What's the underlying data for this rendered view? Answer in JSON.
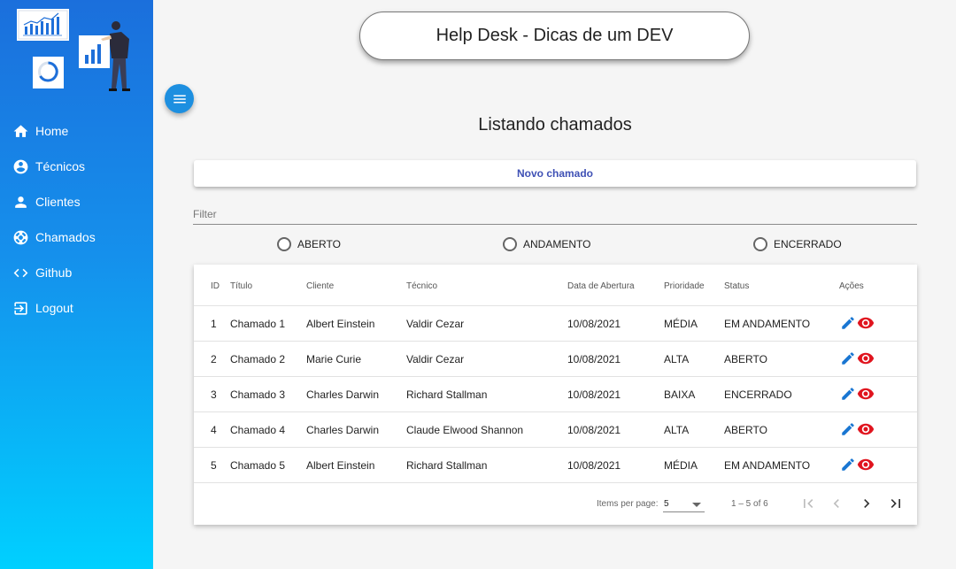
{
  "app": {
    "title": "Help Desk - Dicas de um DEV"
  },
  "sidebar": {
    "items": [
      {
        "label": "Home",
        "icon": "home-icon"
      },
      {
        "label": "Técnicos",
        "icon": "account-circle-icon"
      },
      {
        "label": "Clientes",
        "icon": "person-icon"
      },
      {
        "label": "Chamados",
        "icon": "support-icon"
      },
      {
        "label": "Github",
        "icon": "code-icon"
      },
      {
        "label": "Logout",
        "icon": "logout-icon"
      }
    ]
  },
  "main": {
    "heading": "Listando chamados",
    "new_button": "Novo chamado",
    "filter": {
      "placeholder": "Filter",
      "value": ""
    },
    "status_filters": [
      "ABERTO",
      "ANDAMENTO",
      "ENCERRADO"
    ],
    "table": {
      "columns": [
        "ID",
        "Título",
        "Cliente",
        "Técnico",
        "Data de Abertura",
        "Prioridade",
        "Status",
        "Ações"
      ],
      "rows": [
        [
          "1",
          "Chamado 1",
          "Albert Einstein",
          "Valdir Cezar",
          "10/08/2021",
          "MÉDIA",
          "EM ANDAMENTO"
        ],
        [
          "2",
          "Chamado 2",
          "Marie Curie",
          "Valdir Cezar",
          "10/08/2021",
          "ALTA",
          "ABERTO"
        ],
        [
          "3",
          "Chamado 3",
          "Charles Darwin",
          "Richard Stallman",
          "10/08/2021",
          "BAIXA",
          "ENCERRADO"
        ],
        [
          "4",
          "Chamado 4",
          "Charles Darwin",
          "Claude Elwood Shannon",
          "10/08/2021",
          "ALTA",
          "ABERTO"
        ],
        [
          "5",
          "Chamado 5",
          "Albert Einstein",
          "Richard Stallman",
          "10/08/2021",
          "MÉDIA",
          "EM ANDAMENTO"
        ]
      ]
    },
    "paginator": {
      "items_per_page_label": "Items per page:",
      "items_per_page": "5",
      "range": "1 – 5 of 6"
    }
  },
  "colors": {
    "sidebar_top": "#1b6fdc",
    "sidebar_bottom": "#00d0ff",
    "edit_icon": "#1976d2",
    "view_icon": "#e0141e",
    "accent": "#3f51b5"
  }
}
